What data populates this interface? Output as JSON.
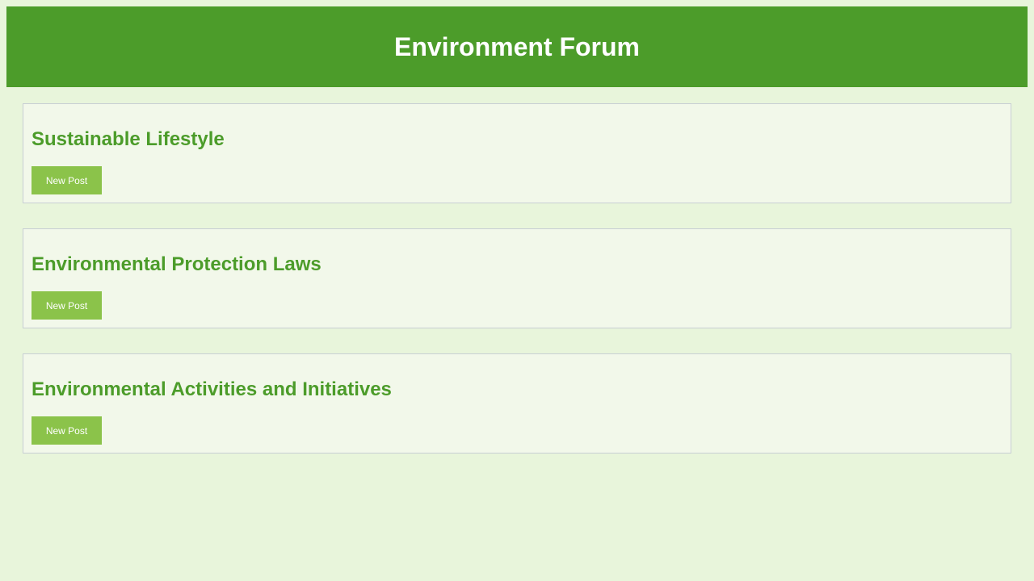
{
  "header": {
    "title": "Environment Forum"
  },
  "categories": [
    {
      "title": "Sustainable Lifestyle",
      "button_label": "New Post"
    },
    {
      "title": "Environmental Protection Laws",
      "button_label": "New Post"
    },
    {
      "title": "Environmental Activities and Initiatives",
      "button_label": "New Post"
    }
  ],
  "colors": {
    "header_bg": "#4c9c2a",
    "page_bg": "#e8f5db",
    "card_bg": "#f2f8ea",
    "title_text": "#4c9c2a",
    "button_bg": "#8bc34a"
  }
}
